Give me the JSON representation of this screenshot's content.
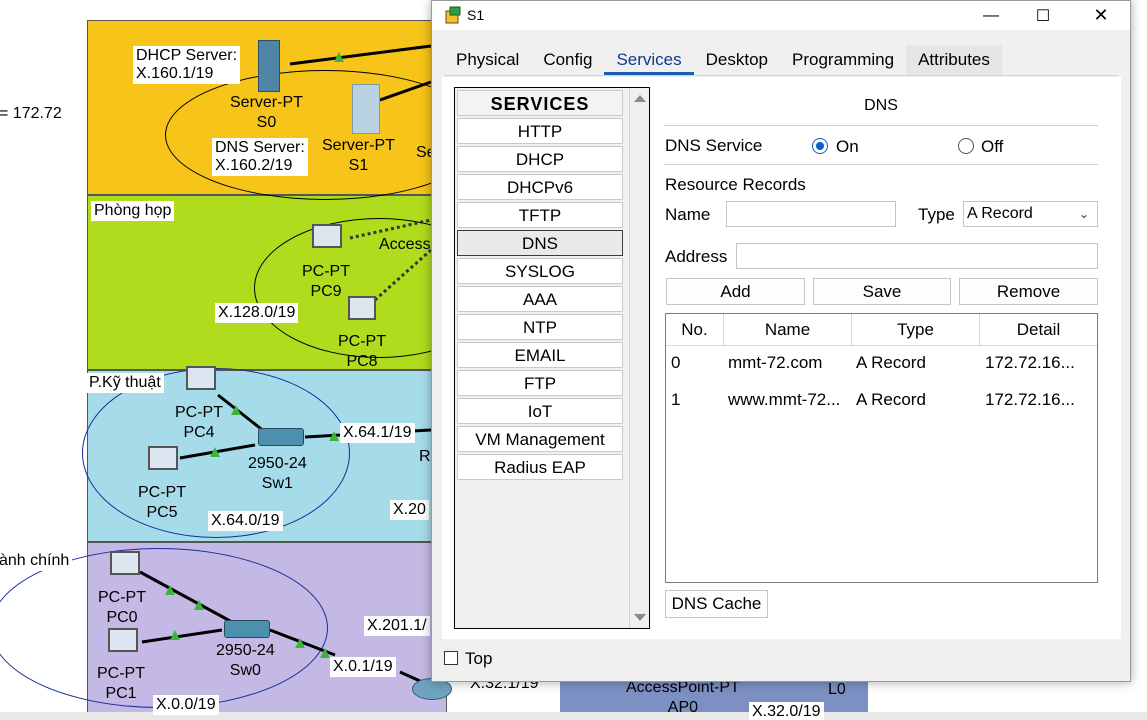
{
  "topology": {
    "edge_label": "= 172.72",
    "dhcp_server": "DHCP Server:\nX.160.1/19",
    "dns_server": "DNS Server:\nX.160.2/19",
    "server_s0": "Server-PT\nS0",
    "server_s1": "Server-PT\nS1",
    "server_s2_partial": "Se",
    "meeting_room": "Phòng họp",
    "access_partial": "Access",
    "pc9": "PC-PT\nPC9",
    "pc8": "PC-PT\nPC8",
    "subnet_128": "X.128.0/19",
    "tech_room": "P.Kỹ thuật",
    "pc4": "PC-PT\nPC4",
    "pc5": "PC-PT\nPC5",
    "sw1": "2950-24\nSw1",
    "subnet_64_1": "X.64.1/19",
    "subnet_64_0": "X.64.0/19",
    "router_partial": "R",
    "subnet_20_partial": "X.20",
    "admin_room": "ành chính",
    "pc0": "PC-PT\nPC0",
    "pc1": "PC-PT\nPC1",
    "sw0": "2950-24\nSw0",
    "subnet_201_partial": "X.201.1/",
    "subnet_0_1": "X.0.1/19",
    "subnet_0_0": "X.0.0/19",
    "subnet_32_1_partial": "X.32.1/19",
    "accesspoint": "AccessPoint-PT\nAP0",
    "l0": "L0",
    "subnet_32_0": "X.32.0/19",
    "colors": {
      "server_zone": "#f7c419",
      "meeting_zone": "#b0dc1e",
      "tech_zone": "#a6dbea",
      "admin_zone": "#c3b9e4",
      "bottom_zone": "#7d90c3"
    }
  },
  "dialog": {
    "title": "S1",
    "controls": {
      "minimize": "—",
      "maximize": "☐",
      "close": "✕"
    },
    "tabs": [
      "Physical",
      "Config",
      "Services",
      "Desktop",
      "Programming",
      "Attributes"
    ],
    "active_tab": "Services",
    "services": {
      "header": "SERVICES",
      "items": [
        "HTTP",
        "DHCP",
        "DHCPv6",
        "TFTP",
        "DNS",
        "SYSLOG",
        "AAA",
        "NTP",
        "EMAIL",
        "FTP",
        "IoT",
        "VM Management",
        "Radius EAP"
      ],
      "selected": "DNS"
    },
    "dns": {
      "title": "DNS",
      "service_label": "DNS Service",
      "on_label": "On",
      "off_label": "Off",
      "service_state": "On",
      "resource_records_label": "Resource Records",
      "name_label": "Name",
      "name_value": "",
      "type_label": "Type",
      "type_value": "A Record",
      "address_label": "Address",
      "address_value": "",
      "add_button": "Add",
      "save_button": "Save",
      "remove_button": "Remove",
      "table": {
        "columns": [
          "No.",
          "Name",
          "Type",
          "Detail"
        ],
        "rows": [
          {
            "no": "0",
            "name": "mmt-72.com",
            "type": "A Record",
            "detail": "172.72.16..."
          },
          {
            "no": "1",
            "name": "www.mmt-72...",
            "type": "A Record",
            "detail": "172.72.16..."
          }
        ]
      },
      "cache_button": "DNS Cache"
    },
    "top_checkbox_label": "Top",
    "top_checked": false
  }
}
